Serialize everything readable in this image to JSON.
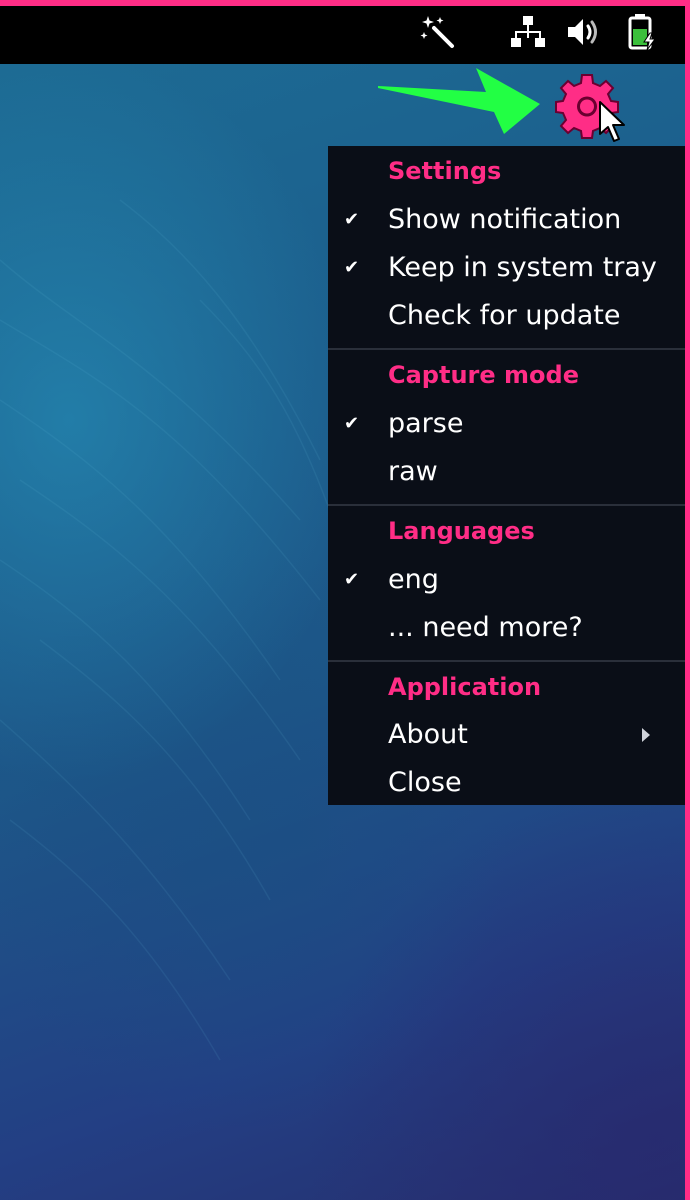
{
  "colors": {
    "accent": "#ff2d86",
    "menu_bg": "#0a0e17",
    "arrow_green": "#22ff44",
    "topbar_bg": "#000000"
  },
  "tray": {
    "icons": [
      "magic-wand-icon",
      "network-icon",
      "volume-icon",
      "battery-charging-icon",
      "gear-icon"
    ]
  },
  "menu": {
    "check_glyph": "✔",
    "sections": [
      {
        "header": "Settings",
        "items": [
          {
            "label": "Show notification",
            "checked": true
          },
          {
            "label": "Keep in system tray",
            "checked": true
          },
          {
            "label": "Check for update",
            "checked": false
          }
        ]
      },
      {
        "header": "Capture mode",
        "items": [
          {
            "label": "parse",
            "checked": true
          },
          {
            "label": "raw",
            "checked": false
          }
        ]
      },
      {
        "header": "Languages",
        "items": [
          {
            "label": "eng",
            "checked": true
          },
          {
            "label": "... need more?",
            "checked": false
          }
        ]
      },
      {
        "header": "Application",
        "items": [
          {
            "label": "About",
            "checked": false,
            "submenu": true
          },
          {
            "label": "Close",
            "checked": false
          }
        ]
      }
    ]
  }
}
